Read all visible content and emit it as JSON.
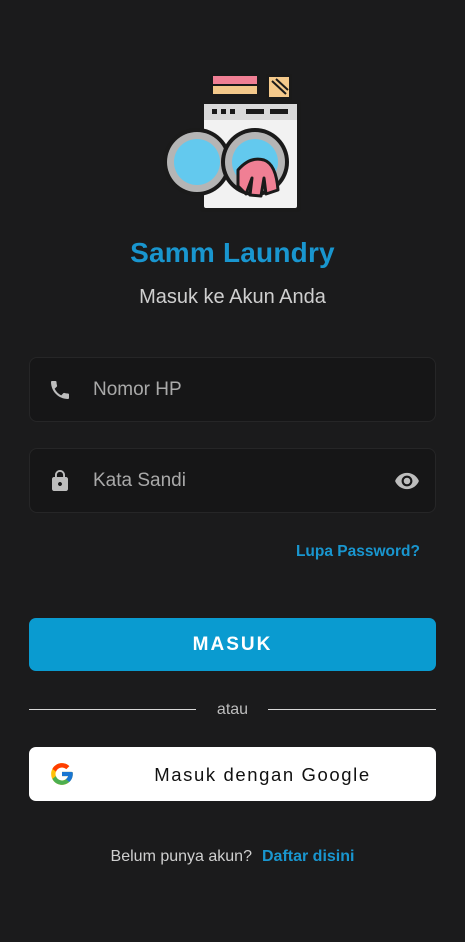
{
  "app": {
    "title": "Samm Laundry",
    "subtitle": "Masuk ke Akun Anda",
    "logo_icon": "washing-machine-icon"
  },
  "form": {
    "phone": {
      "placeholder": "Nomor HP",
      "value": "",
      "icon": "phone-icon"
    },
    "password": {
      "placeholder": "Kata Sandi",
      "value": "",
      "icon": "lock-icon",
      "toggle_icon": "eye-icon"
    },
    "forgot_label": "Lupa Password?",
    "submit_label": "MASUK"
  },
  "divider": {
    "label": "atau"
  },
  "google": {
    "label": "Masuk dengan Google",
    "icon": "google-icon"
  },
  "signup": {
    "question": "Belum punya akun?",
    "link_label": "Daftar disini"
  },
  "colors": {
    "background": "#1b1b1c",
    "accent": "#1996cf",
    "button": "#0a9bd0",
    "field_bg": "#161617"
  }
}
